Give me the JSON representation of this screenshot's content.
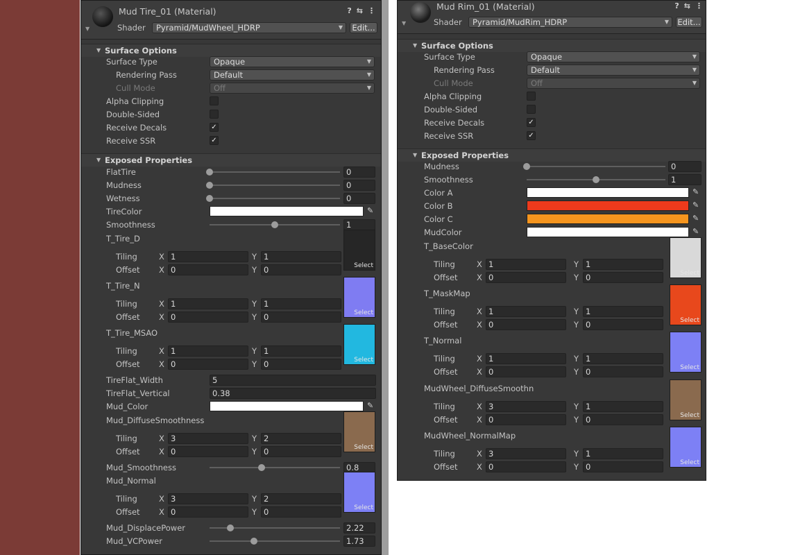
{
  "colors": {
    "bg_left": "#7b3b36",
    "bg_mid": "#9e9e9e",
    "panel": "#383838",
    "field": "#2a2a2a",
    "checkmark": "#ececec"
  },
  "icons": {
    "help": "help-icon",
    "settings": "sliders-icon",
    "more": "kebab-menu-icon",
    "fold": "fold-triangle-icon",
    "picker": "eyedropper-icon"
  },
  "left": {
    "title": "Mud Tire_01 (Material)",
    "shader_label": "Shader",
    "shader_value": "Pyramid/MudWheel_HDRP",
    "edit_label": "Edit...",
    "surface_header": "Surface Options",
    "surface": {
      "surface_type": {
        "label": "Surface Type",
        "value": "Opaque"
      },
      "rendering_pass": {
        "label": "Rendering Pass",
        "value": "Default"
      },
      "cull_mode": {
        "label": "Cull Mode",
        "value": "Off"
      },
      "alpha_clipping": {
        "label": "Alpha Clipping",
        "checked": false
      },
      "double_sided": {
        "label": "Double-Sided",
        "checked": false
      },
      "receive_decals": {
        "label": "Receive Decals",
        "checked": true
      },
      "receive_ssr": {
        "label": "Receive SSR",
        "checked": true
      }
    },
    "exposed_header": "Exposed Properties",
    "sliders": [
      {
        "label": "FlatTire",
        "value": "0",
        "fraction": 0.0
      },
      {
        "label": "Mudness",
        "value": "0",
        "fraction": 0.0
      },
      {
        "label": "Wetness",
        "value": "0",
        "fraction": 0.0
      },
      {
        "label": "Smoothness",
        "value": "1",
        "fraction": 0.5
      },
      {
        "label": "Mud_Smoothness",
        "value": "0.8",
        "fraction": 0.4
      },
      {
        "label": "Mud_DisplacePower",
        "value": "2.22",
        "fraction": 0.16
      },
      {
        "label": "Mud_VCPower",
        "value": "1.73",
        "fraction": 0.34
      }
    ],
    "colorprops": [
      {
        "label": "TireColor",
        "color": "#ffffff"
      },
      {
        "label": "Mud_Color",
        "color": "#ffffff"
      }
    ],
    "floats": [
      {
        "label": "TireFlat_Width",
        "value": "5"
      },
      {
        "label": "TireFlat_Vertical",
        "value": "0.38"
      }
    ],
    "textures": [
      {
        "label": "T_Tire_D",
        "tiling_x": "1",
        "tiling_y": "1",
        "offset_x": "0",
        "offset_y": "0",
        "thumb": "#262626"
      },
      {
        "label": "T_Tire_N",
        "tiling_x": "1",
        "tiling_y": "1",
        "offset_x": "0",
        "offset_y": "0",
        "thumb": "#7f7cf2"
      },
      {
        "label": "T_Tire_MSAO",
        "tiling_x": "1",
        "tiling_y": "1",
        "offset_x": "0",
        "offset_y": "0",
        "thumb": "#22b8e0"
      },
      {
        "label": "Mud_DiffuseSmoothness",
        "tiling_x": "3",
        "tiling_y": "2",
        "offset_x": "0",
        "offset_y": "0",
        "thumb": "#8a6a4e"
      },
      {
        "label": "Mud_Normal",
        "tiling_x": "3",
        "tiling_y": "2",
        "offset_x": "0",
        "offset_y": "0",
        "thumb": "#7d80f5"
      }
    ]
  },
  "right": {
    "title": "Mud Rim_01 (Material)",
    "shader_label": "Shader",
    "shader_value": "Pyramid/MudRim_HDRP",
    "edit_label": "Edit...",
    "surface_header": "Surface Options",
    "surface": {
      "surface_type": {
        "label": "Surface Type",
        "value": "Opaque"
      },
      "rendering_pass": {
        "label": "Rendering Pass",
        "value": "Default"
      },
      "cull_mode": {
        "label": "Cull Mode",
        "value": "Off"
      },
      "alpha_clipping": {
        "label": "Alpha Clipping",
        "checked": false
      },
      "double_sided": {
        "label": "Double-Sided",
        "checked": false
      },
      "receive_decals": {
        "label": "Receive Decals",
        "checked": true
      },
      "receive_ssr": {
        "label": "Receive SSR",
        "checked": true
      }
    },
    "exposed_header": "Exposed Properties",
    "sliders": [
      {
        "label": "Mudness",
        "value": "0",
        "fraction": 0.0
      },
      {
        "label": "Smoothness",
        "value": "1",
        "fraction": 0.5
      }
    ],
    "colorprops": [
      {
        "label": "Color A",
        "color": "#ffffff"
      },
      {
        "label": "Color B",
        "color": "#ee3a1c"
      },
      {
        "label": "Color C",
        "color": "#f6951e"
      },
      {
        "label": "MudColor",
        "color": "#ffffff"
      }
    ],
    "textures": [
      {
        "label": "T_BaseColor",
        "tiling_x": "1",
        "tiling_y": "1",
        "offset_x": "0",
        "offset_y": "0",
        "thumb": "#d9d9d9"
      },
      {
        "label": "T_MaskMap",
        "tiling_x": "1",
        "tiling_y": "1",
        "offset_x": "0",
        "offset_y": "0",
        "thumb": "#e8481c"
      },
      {
        "label": "T_Normal",
        "tiling_x": "1",
        "tiling_y": "1",
        "offset_x": "0",
        "offset_y": "0",
        "thumb": "#7d80f5"
      },
      {
        "label": "MudWheel_DiffuseSmoothn",
        "tiling_x": "3",
        "tiling_y": "1",
        "offset_x": "0",
        "offset_y": "0",
        "thumb": "#8a6a4e"
      },
      {
        "label": "MudWheel_NormalMap",
        "tiling_x": "3",
        "tiling_y": "1",
        "offset_x": "0",
        "offset_y": "0",
        "thumb": "#7d80f5"
      }
    ]
  },
  "common": {
    "tiling_label": "Tiling",
    "offset_label": "Offset",
    "x_label": "X",
    "y_label": "Y",
    "select_label": "Select"
  }
}
